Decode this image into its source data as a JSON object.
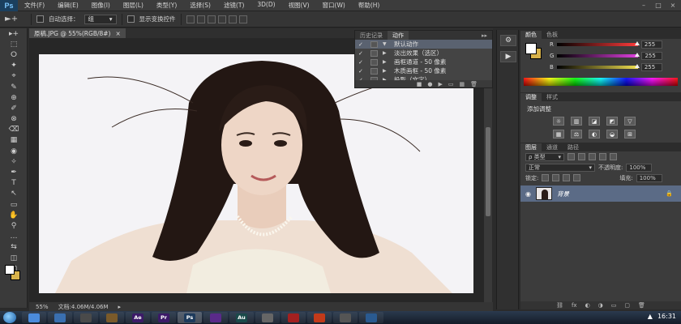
{
  "app": {
    "logo": "Ps"
  },
  "menu": [
    "文件(F)",
    "编辑(E)",
    "图像(I)",
    "图层(L)",
    "类型(Y)",
    "选择(S)",
    "滤镜(T)",
    "3D(D)",
    "视图(V)",
    "窗口(W)",
    "帮助(H)"
  ],
  "window_controls": [
    "–",
    "□",
    "×"
  ],
  "options": {
    "tool_glyph": "►+",
    "auto_select_label": "自动选择：",
    "auto_select_value": "组",
    "transform_label": "显示变换控件"
  },
  "tools": [
    "▸+",
    "⬚",
    "ⵔ",
    "✦",
    "⌖",
    "✎",
    "⊕",
    "✐",
    "⊗",
    "⌫",
    "▦",
    "◉",
    "✧",
    "✒",
    "T",
    "↖",
    "▭",
    "✋",
    "⚲",
    "…",
    "⇆",
    "◫",
    "▢"
  ],
  "document": {
    "tab_title": "原稿.JPG @ 55%(RGB/8#)",
    "tab_close": "×",
    "zoom": "55%",
    "doc_info": "文档:4.06M/4.06M"
  },
  "actions_panel": {
    "tabs": [
      "历史记录",
      "动作"
    ],
    "active_tab": 1,
    "menu_icon": "▸▸",
    "rows": [
      {
        "check": "✓",
        "tri": "▼",
        "label": "默认动作"
      },
      {
        "check": "✓",
        "tri": "▶",
        "label": "淡出效果（选区）"
      },
      {
        "check": "✓",
        "tri": "▶",
        "label": "画框通道 - 50 像素"
      },
      {
        "check": "✓",
        "tri": "▶",
        "label": "木质画框 - 50 像素"
      },
      {
        "check": "✓",
        "tri": "▶",
        "label": "投影（文字）"
      }
    ],
    "footer_icons": [
      "■",
      "●",
      "▶",
      "▭",
      "▦",
      "🗑"
    ]
  },
  "dock": {
    "buttons": [
      "⚙",
      "▶"
    ]
  },
  "color_panel": {
    "tabs": [
      "颜色",
      "色板"
    ],
    "active_tab": 0,
    "channels": [
      {
        "label": "R",
        "value": "255",
        "color": "#ff3b3b"
      },
      {
        "label": "G",
        "value": "255",
        "color": "#e040e0"
      },
      {
        "label": "B",
        "value": "255",
        "color": "#f0e050"
      }
    ]
  },
  "adjustments_panel": {
    "tabs": [
      "调整",
      "样式"
    ],
    "active_tab": 0,
    "add_label": "添加调整",
    "icons": [
      "☼",
      "▥",
      "◪",
      "◩",
      "▽",
      "",
      "▦",
      "⚖",
      "◐",
      "◒",
      "⊞",
      "",
      "◧",
      "◨",
      "▨",
      "▩"
    ]
  },
  "layers_panel": {
    "tabs": [
      "图层",
      "通道",
      "路径"
    ],
    "active_tab": 0,
    "filter_label": "ρ 类型",
    "blend_mode": "正常",
    "opacity_label": "不透明度:",
    "opacity_value": "100%",
    "lock_label": "锁定:",
    "fill_label": "填充:",
    "fill_value": "100%",
    "layer": {
      "visibility": "◉",
      "name": "背景",
      "lock": "🔒"
    },
    "footer_icons": [
      "⛓",
      "fx",
      "◐",
      "◑",
      "▭",
      "▢",
      "🗑"
    ]
  },
  "taskbar": {
    "apps": [
      {
        "label": "",
        "bg": "#4b8bdc"
      },
      {
        "label": "",
        "bg": "#3a6fb0"
      },
      {
        "label": "",
        "bg": "#4a4a4a"
      },
      {
        "label": "",
        "bg": "#7a5a2a"
      },
      {
        "label": "Ae",
        "bg": "#3c1a68"
      },
      {
        "label": "Pr",
        "bg": "#3c1a68"
      },
      {
        "label": "Ps",
        "bg": "#1d3a5c"
      },
      {
        "label": "",
        "bg": "#5a2a8a"
      },
      {
        "label": "Au",
        "bg": "#1a4a4a"
      },
      {
        "label": "",
        "bg": "#666"
      },
      {
        "label": "",
        "bg": "#a32020"
      },
      {
        "label": "",
        "bg": "#c23a1a"
      },
      {
        "label": "",
        "bg": "#555"
      },
      {
        "label": "",
        "bg": "#2a5a90"
      }
    ],
    "clock": "16:31"
  }
}
